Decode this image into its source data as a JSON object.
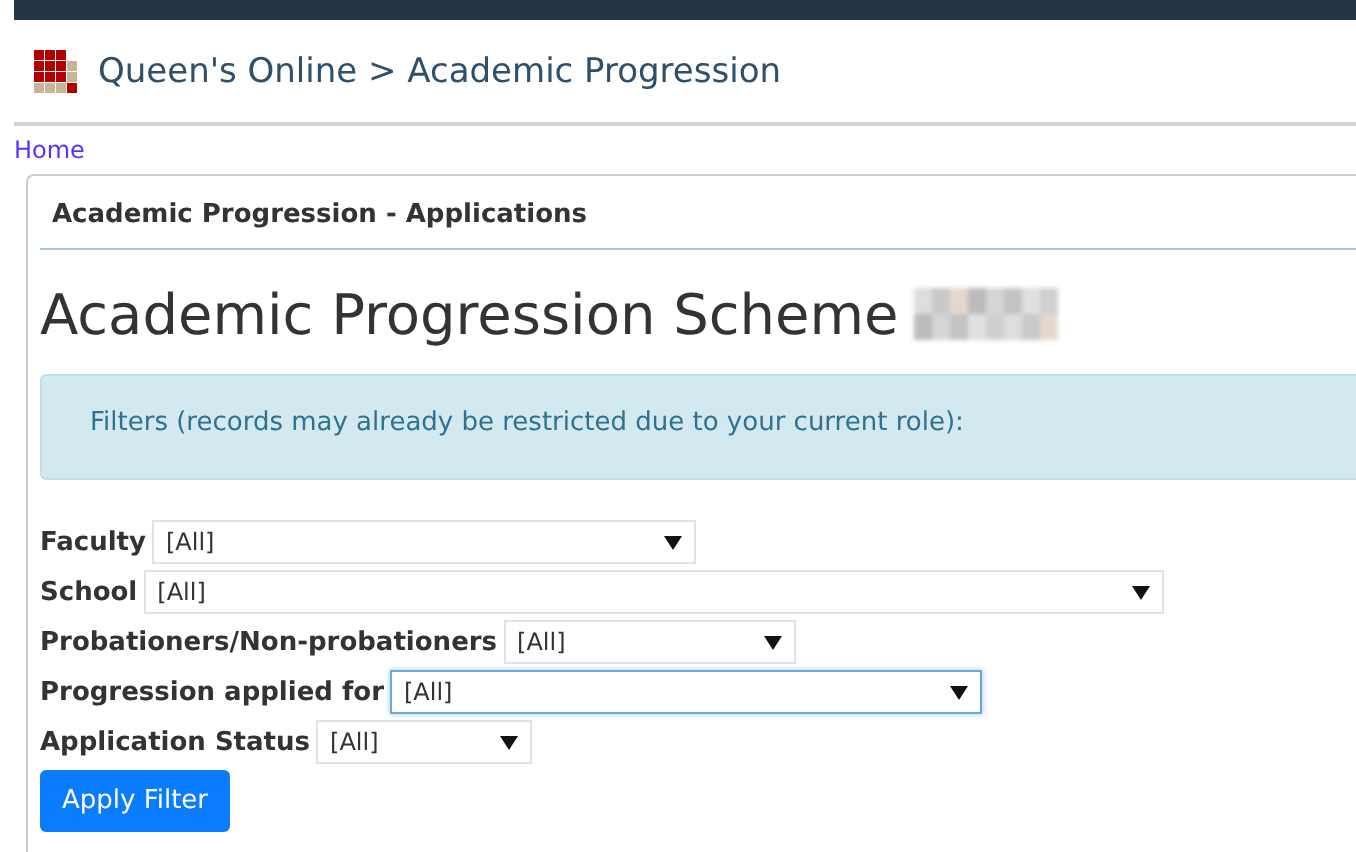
{
  "header": {
    "title": "Queen's Online > Academic Progression"
  },
  "breadcrumb": {
    "home": "Home"
  },
  "panel": {
    "heading": "Academic Progression - Applications",
    "title": "Academic Progression Scheme",
    "alert": "Filters (records may already be restricted due to your current role):",
    "filters": [
      {
        "label": "Faculty",
        "value": "[All]",
        "focused": false
      },
      {
        "label": "School",
        "value": "[All]",
        "focused": false
      },
      {
        "label": "Probationers/Non-probationers",
        "value": "[All]",
        "focused": false
      },
      {
        "label": "Progression applied for",
        "value": "[All]",
        "focused": true
      },
      {
        "label": "Application Status",
        "value": "[All]",
        "focused": false
      }
    ],
    "button": "Apply Filter"
  }
}
